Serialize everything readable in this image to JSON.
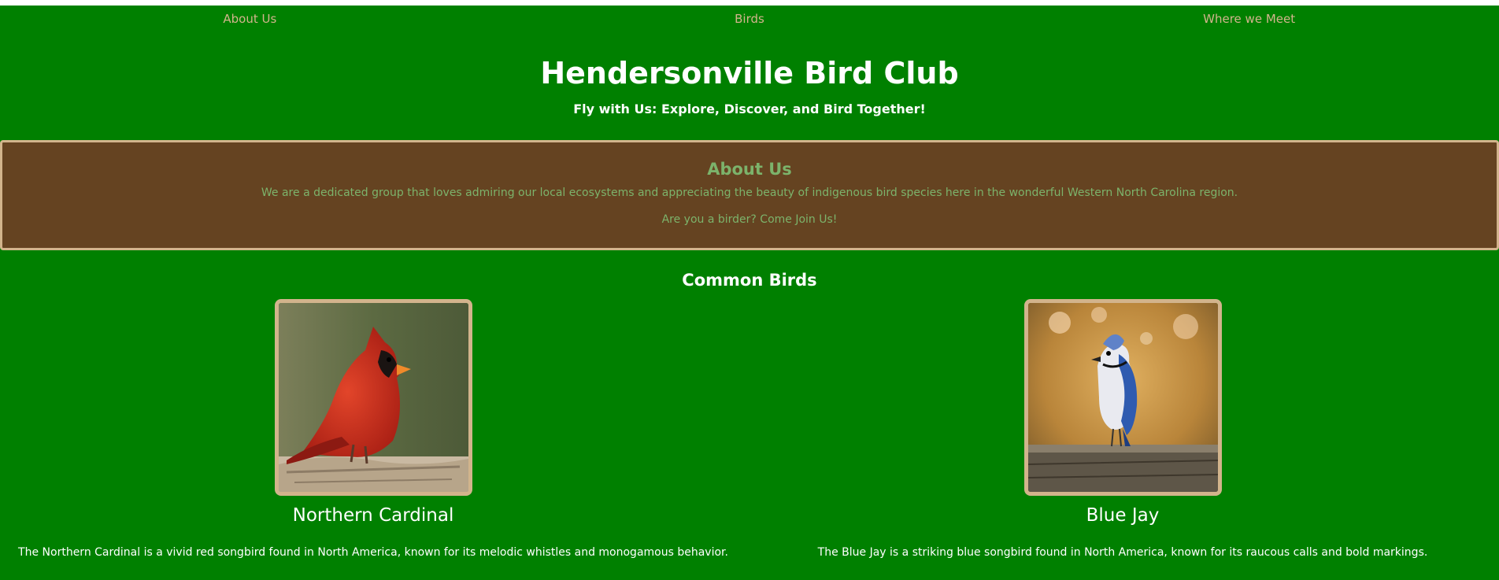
{
  "nav": {
    "items": [
      {
        "label": "About Us"
      },
      {
        "label": "Birds"
      },
      {
        "label": "Where we Meet"
      }
    ]
  },
  "header": {
    "title": "Hendersonville Bird Club",
    "tagline": "Fly with Us: Explore, Discover, and Bird Together!"
  },
  "about": {
    "heading": "About Us",
    "paragraph1": "We are a dedicated group that loves admiring our local ecosystems and appreciating the beauty of indigenous bird species here in the wonderful Western North Carolina region.",
    "paragraph2": "Are you a birder? Come Join Us!"
  },
  "birds": {
    "heading": "Common Birds",
    "cards": [
      {
        "name": "Northern Cardinal",
        "description": "The Northern Cardinal is a vivid red songbird found in North America, known for its melodic whistles and monogamous behavior."
      },
      {
        "name": "Blue Jay",
        "description": "The Blue Jay is a striking blue songbird found in North America, known for its raucous calls and bold markings."
      }
    ]
  },
  "colors": {
    "page_background": "#008000",
    "about_background": "#654321",
    "accent_tan": "#d2b48c",
    "about_text": "#7cb36b",
    "heading_text": "#ffffff"
  }
}
